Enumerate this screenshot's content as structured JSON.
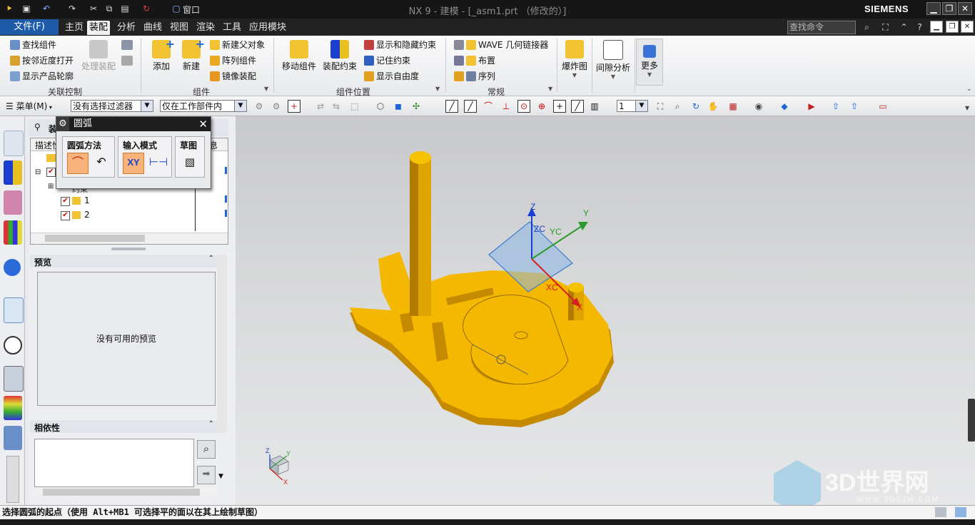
{
  "window": {
    "title": "NX 9 - 建模 - [_asm1.prt （修改的）]",
    "brand": "SIEMENS",
    "window_menu": "窗口",
    "win_minimize": "▁",
    "win_restore": "❐",
    "win_close": "✕"
  },
  "menu_tabs": {
    "file": "文件(F)",
    "tabs": [
      "主页",
      "装配",
      "分析",
      "曲线",
      "视图",
      "渲染",
      "工具",
      "应用模块"
    ],
    "active": "装配",
    "search_placeholder": "查找命令"
  },
  "ribbon": {
    "group1": {
      "items": [
        "查找组件",
        "按邻近度打开",
        "显示产品轮廓"
      ],
      "disabled_button": "处理装配",
      "label": "关联控制"
    },
    "group2": {
      "add": "添加",
      "new": "新建",
      "items": [
        "新建父对象",
        "阵列组件",
        "镜像装配"
      ],
      "label": "组件"
    },
    "group3": {
      "move": "移动组件",
      "constraint": "装配约束",
      "items": [
        "显示和隐藏约束",
        "记住约束",
        "显示自由度"
      ],
      "label": "组件位置"
    },
    "group4": {
      "items": [
        "WAVE 几何链接器",
        "布置",
        "序列"
      ],
      "label": "常规"
    },
    "explode": "爆炸图",
    "clearance": "间隙分析",
    "more": "更多"
  },
  "toolbar": {
    "menu": "菜单(M)",
    "filter": "没有选择过滤器",
    "scope": "仅在工作部件内",
    "layer": "1"
  },
  "dialog": {
    "title": "圆弧",
    "group_method": "圆弧方法",
    "group_input": "输入模式",
    "group_sketch": "草图",
    "xy": "XY"
  },
  "navigator": {
    "title": "装",
    "col_desc": "描述性",
    "col_info": "息",
    "rows": [
      "1",
      "2"
    ],
    "trunc_row": "约束",
    "preview_header": "预览",
    "preview_empty": "没有可用的预览",
    "depend_header": "相依性"
  },
  "viewport": {
    "triad_labels": {
      "z": "Z",
      "y": "Y",
      "zc": "ZC",
      "yc": "YC",
      "xc": "XC",
      "x": "X"
    },
    "mini_triad": {
      "z": "Z",
      "y": "Y",
      "x": "X"
    },
    "watermark": "3D世界网",
    "watermark_url": "WWW.3DSJW.COM"
  },
  "status_text": "选择圆弧的起点（使用 Alt+MB1 可选择平的面以在其上绘制草图）",
  "colors": {
    "part": "#f5b800",
    "part_dark": "#c98d00",
    "accent": "#1d5aa8"
  }
}
